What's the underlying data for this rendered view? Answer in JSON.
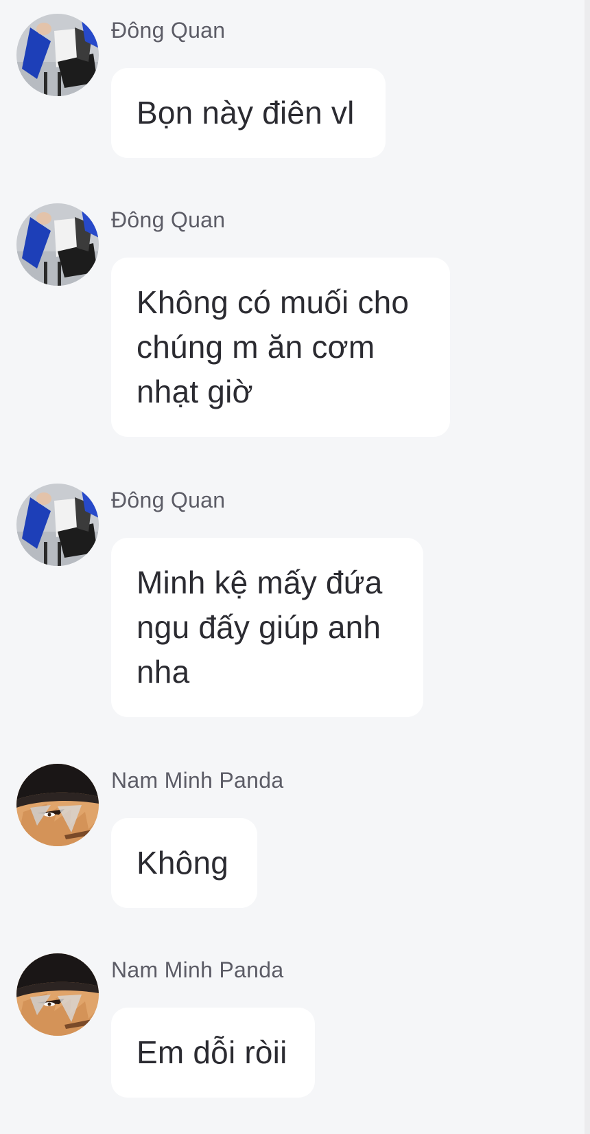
{
  "messages": [
    {
      "sender": "Đông Quan",
      "avatar": "dong-quan-avatar",
      "text": "Bọn này điên vl"
    },
    {
      "sender": "Đông Quan",
      "avatar": "dong-quan-avatar",
      "text": "Không có muối cho\nchúng m ăn cơm\nnhạt giờ"
    },
    {
      "sender": "Đông Quan",
      "avatar": "dong-quan-avatar",
      "text": "Minh kệ mấy đứa\nngu đấy giúp anh\nnha"
    },
    {
      "sender": "Nam Minh Panda",
      "avatar": "nam-minh-panda-avatar",
      "text": "Không"
    },
    {
      "sender": "Nam Minh Panda",
      "avatar": "nam-minh-panda-avatar",
      "text": "Em dỗi ròii"
    }
  ],
  "colors": {
    "background": "#f5f6f8",
    "bubble": "#ffffff",
    "sender_text": "#5c5c66",
    "message_text": "#2b2b31"
  }
}
